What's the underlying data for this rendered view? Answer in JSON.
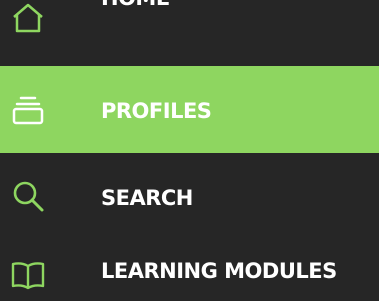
{
  "colors": {
    "background": "#262626",
    "active_background": "#8ed660",
    "icon_accent": "#8ed660",
    "label_text": "#ffffff"
  },
  "nav": {
    "items": [
      {
        "label": "HOME",
        "icon": "home-icon",
        "active": false
      },
      {
        "label": "PROFILES",
        "icon": "stack-icon",
        "active": true
      },
      {
        "label": "SEARCH",
        "icon": "search-icon",
        "active": false
      },
      {
        "label": "LEARNING MODULES",
        "icon": "book-icon",
        "active": false
      }
    ]
  }
}
